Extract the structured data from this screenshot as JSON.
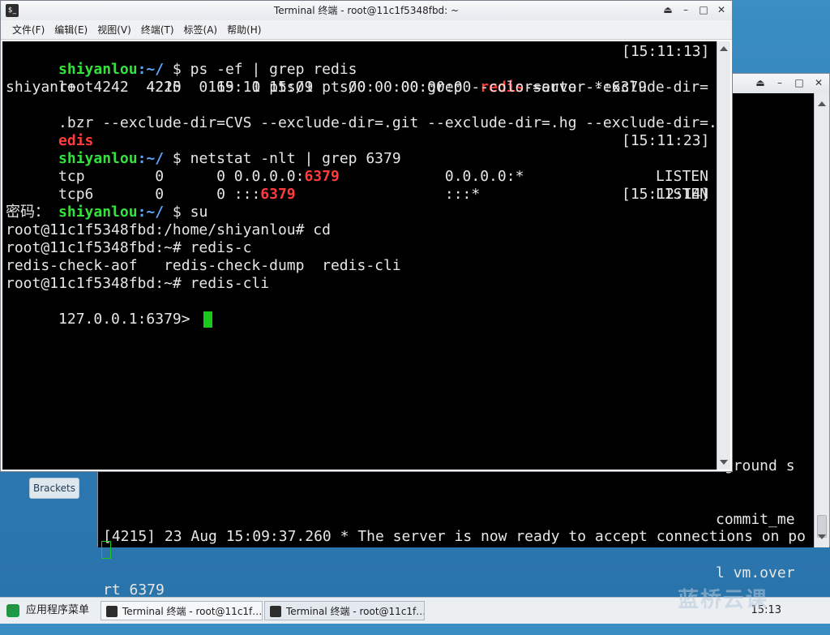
{
  "desktop": {
    "icon_label": "Brackets"
  },
  "back_window": {
    "right_fragments": [
      "kground s",
      "commit_me",
      "l vm.over"
    ],
    "log_lines": [
      "[4215] 23 Aug 15:09:37.260 * The server is now ready to accept connections on po",
      "rt 6379"
    ]
  },
  "front_window": {
    "title": "Terminal 终端 - root@11c1f5348fbd: ~",
    "menu": [
      "文件(F)",
      "编辑(E)",
      "视图(V)",
      "终端(T)",
      "标签(A)",
      "帮助(H)"
    ],
    "lines": {
      "l1_user": "shiyanlou",
      "l1_path": ":~/",
      "l1_cmd": " $ ps -ef | grep redis",
      "l1_time": "[15:11:13]",
      "l2_a": "root      4215   169  0 15:09 pts/0    00:00:00 ",
      "l2_red": "redis",
      "l2_b": "-server *:6379",
      "l3": "shiyanl+  4242  4220  0 15:11 pts/1    00:00:00 grep --color=auto --exclude-dir=",
      "l4_a": ".bzr --exclude-dir=CVS --exclude-dir=.git --exclude-dir=.hg --exclude-dir=.svn ",
      "l4_red": "r",
      "l5_red": "edis",
      "l6_user": "shiyanlou",
      "l6_path": ":~/",
      "l6_cmd": " $ netstat -nlt | grep 6379",
      "l6_time": "[15:11:23]",
      "l7_a": "tcp        0      0 0.0.0.0:",
      "l7_red": "6379",
      "l7_b": "            0.0.0.0:*               LISTEN",
      "l8_a": "tcp6       0      0 :::",
      "l8_red": "6379",
      "l8_b": "                 :::*                    LISTEN",
      "l9_user": "shiyanlou",
      "l9_path": ":~/",
      "l9_cmd": " $ su",
      "l9_time": "[15:12:14]",
      "l10": "密码：",
      "l11": "root@11c1f5348fbd:/home/shiyanlou# cd",
      "l12": "root@11c1f5348fbd:~# redis-c",
      "l13": "redis-check-aof   redis-check-dump  redis-cli",
      "l14": "root@11c1f5348fbd:~# redis-cli",
      "l15": "127.0.0.1:6379> "
    }
  },
  "taskbar": {
    "start_label": "应用程序菜单",
    "tasks": [
      "Terminal 终端 - root@11c1f…",
      "Terminal 终端 - root@11c1f…"
    ],
    "clock": "15:13",
    "watermark": "蓝桥云课"
  }
}
